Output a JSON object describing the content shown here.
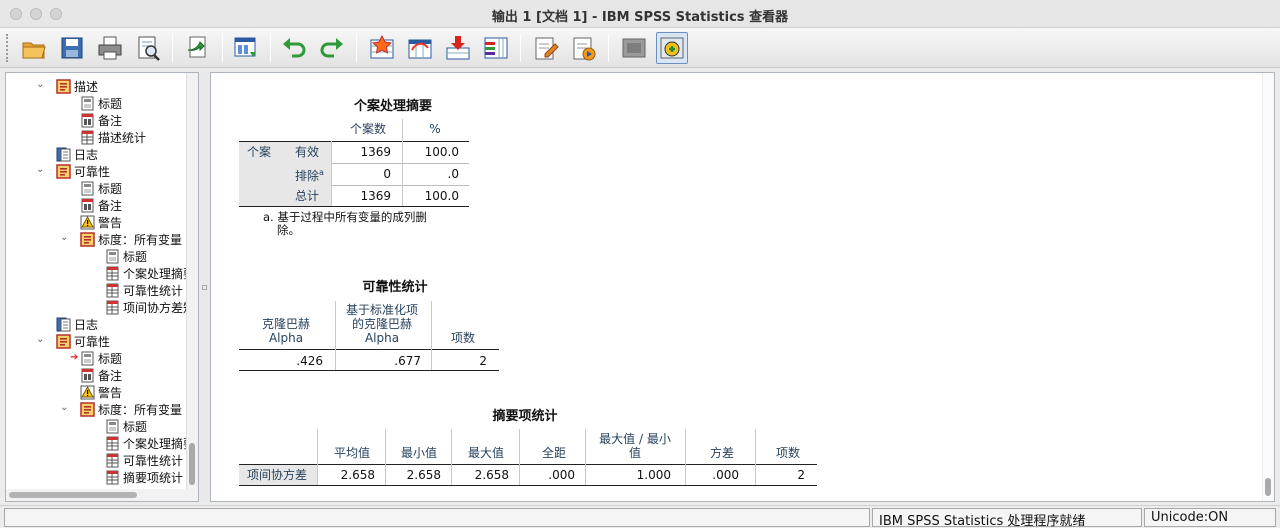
{
  "window": {
    "title": "输出 1 [文档 1] - IBM SPSS Statistics 查看器"
  },
  "toolbar": {
    "buttons": [
      "open-icon",
      "save-icon",
      "print-icon",
      "print-preview-icon",
      "export-icon",
      "goto-data-icon",
      "undo-icon",
      "redo-icon",
      "goto-case-icon",
      "goto-variable-icon",
      "insert-output-icon",
      "variables-icon",
      "edit-output-icon",
      "show-data-icon",
      "hide-icon",
      "designate-window-icon"
    ]
  },
  "outline": {
    "items": [
      {
        "label": "描述",
        "level": 1,
        "icon": "book-icon",
        "twisty": "⌄"
      },
      {
        "label": "标题",
        "level": 2,
        "icon": "title-icon"
      },
      {
        "label": "备注",
        "level": 2,
        "icon": "notes-icon"
      },
      {
        "label": "描述统计",
        "level": 2,
        "icon": "table-icon"
      },
      {
        "label": "日志",
        "level": 1,
        "icon": "log-icon"
      },
      {
        "label": "可靠性",
        "level": 1,
        "icon": "book-icon",
        "twisty": "⌄"
      },
      {
        "label": "标题",
        "level": 2,
        "icon": "title-icon"
      },
      {
        "label": "备注",
        "level": 2,
        "icon": "notes-icon"
      },
      {
        "label": "警告",
        "level": 2,
        "icon": "warning-icon"
      },
      {
        "label": "标度：所有变量",
        "level": 2,
        "icon": "book-icon",
        "twisty": "⌄"
      },
      {
        "label": "标题",
        "level": 3,
        "icon": "title-icon"
      },
      {
        "label": "个案处理摘要",
        "level": 3,
        "icon": "table-icon"
      },
      {
        "label": "可靠性统计",
        "level": 3,
        "icon": "table-icon"
      },
      {
        "label": "项间协方差矩阵",
        "level": 3,
        "icon": "table-icon"
      },
      {
        "label": "日志",
        "level": 1,
        "icon": "log-icon"
      },
      {
        "label": "可靠性",
        "level": 1,
        "icon": "book-icon",
        "twisty": "⌄"
      },
      {
        "label": "标题",
        "level": 2,
        "icon": "title-icon",
        "current": true
      },
      {
        "label": "备注",
        "level": 2,
        "icon": "notes-icon"
      },
      {
        "label": "警告",
        "level": 2,
        "icon": "warning-icon"
      },
      {
        "label": "标度：所有变量",
        "level": 2,
        "icon": "book-icon",
        "twisty": "⌄"
      },
      {
        "label": "标题",
        "level": 3,
        "icon": "title-icon"
      },
      {
        "label": "个案处理摘要",
        "level": 3,
        "icon": "table-icon"
      },
      {
        "label": "可靠性统计",
        "level": 3,
        "icon": "table-icon"
      },
      {
        "label": "摘要项统计",
        "level": 3,
        "icon": "table-icon"
      }
    ]
  },
  "case_summary": {
    "title": "个案处理摘要",
    "col_n": "个案数",
    "col_pct": "%",
    "row_group": "个案",
    "rows": [
      {
        "label": "有效",
        "n": "1369",
        "pct": "100.0"
      },
      {
        "label": "排除",
        "sup": "a",
        "n": "0",
        "pct": ".0"
      },
      {
        "label": "总计",
        "n": "1369",
        "pct": "100.0"
      }
    ],
    "footnote_line1": "a. 基于过程中所有变量的成列删",
    "footnote_line2": "除。"
  },
  "reliability": {
    "title": "可靠性统计",
    "h1_l1": "克隆巴赫",
    "h1_l2": "Alpha",
    "h2_l1": "基于标准化项",
    "h2_l2": "的克隆巴赫",
    "h2_l3": "Alpha",
    "h3": "项数",
    "v1": ".426",
    "v2": ".677",
    "v3": "2"
  },
  "item_summary": {
    "title": "摘要项统计",
    "h_mean": "平均值",
    "h_min": "最小值",
    "h_max": "最大值",
    "h_range": "全距",
    "h_ratio_l1": "最大值 / 最小",
    "h_ratio_l2": "值",
    "h_var": "方差",
    "h_n": "项数",
    "row_label": "项间协方差",
    "mean": "2.658",
    "min": "2.658",
    "max": "2.658",
    "range": ".000",
    "ratio": "1.000",
    "var": ".000",
    "n": "2"
  },
  "status": {
    "processor": "IBM SPSS Statistics 处理程序就绪",
    "unicode": "Unicode:ON"
  }
}
